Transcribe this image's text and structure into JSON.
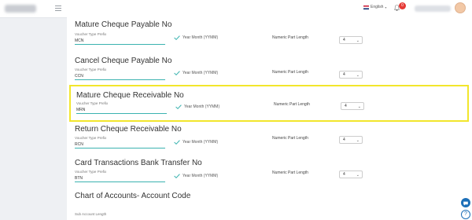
{
  "header": {
    "language": "English",
    "notification_count": "0"
  },
  "sections": [
    {
      "title": "Mature Cheque Payable No",
      "prefix_label": "Voucher Type Prefix",
      "prefix_value": "MCN",
      "year_month_label": "Year Month (YYMM)",
      "numeric_label": "Numeric Part Length",
      "numeric_value": "4"
    },
    {
      "title": "Cancel Cheque Payable No",
      "prefix_label": "Voucher Type Prefix",
      "prefix_value": "CCN",
      "year_month_label": "Year Month (YYMM)",
      "numeric_label": "Numeric Part Length",
      "numeric_value": "4"
    },
    {
      "title": "Mature Cheque Receivable No",
      "prefix_label": "Voucher Type Prefix",
      "prefix_value": "MRN",
      "year_month_label": "Year Month (YYMM)",
      "numeric_label": "Numeric Part Length",
      "numeric_value": "4"
    },
    {
      "title": "Return Cheque Receivable No",
      "prefix_label": "Voucher Type Prefix",
      "prefix_value": "RCN",
      "year_month_label": "Year Month (YYMM)",
      "numeric_label": "Numeric Part Length",
      "numeric_value": "4"
    },
    {
      "title": "Card Transactions Bank Transfer No",
      "prefix_label": "Voucher Type Prefix",
      "prefix_value": "BTN",
      "year_month_label": "Year Month (YYMM)",
      "numeric_label": "Numeric Part Length",
      "numeric_value": "4"
    }
  ],
  "chart_of_accounts": {
    "title": "Chart of Accounts- Account Code",
    "sub_account_label": "Sub Account Length"
  },
  "icons": {
    "check": "check-icon",
    "bell": "bell-icon",
    "chat": "chat-icon",
    "help": "help-icon"
  },
  "colors": {
    "accent": "#3bb3b0",
    "highlight": "#f2e62c",
    "badge": "#e53935",
    "fab": "#1c6fb8"
  }
}
